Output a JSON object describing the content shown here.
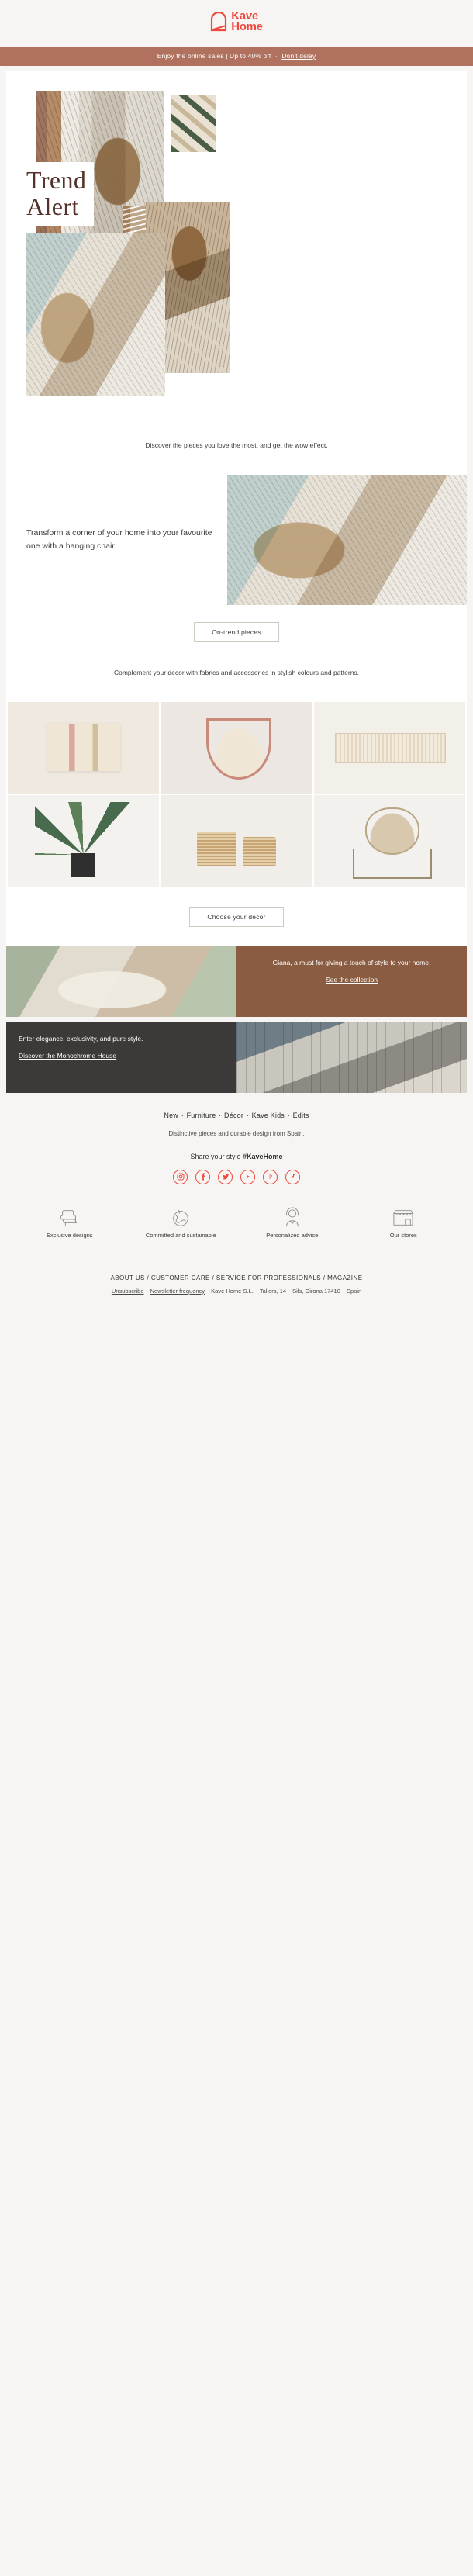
{
  "brand": {
    "name_line1": "Kave",
    "name_line2": "Home",
    "accent_color": "#f0483e",
    "logo_icon": "arch-logo-icon"
  },
  "promo_bar": {
    "text": "Enjoy the online sales | Up to 40% off",
    "separator": "·",
    "link": "Don't delay",
    "background_color": "#b0725e"
  },
  "hero": {
    "title_line1": "Trend",
    "title_line2": "Alert",
    "title_color": "#54322a",
    "images": [
      {
        "name": "hanging-chair-by-window"
      },
      {
        "name": "green-leaf-pattern-swatch"
      },
      {
        "name": "rattan-weave-detail"
      },
      {
        "name": "hanging-chair-with-stand"
      },
      {
        "name": "hanging-chair-terrace"
      }
    ]
  },
  "intro": {
    "text": "Discover the pieces you love the most, and get the wow effect."
  },
  "feature_block": {
    "text": "Transform a corner of your home into your favourite one with a hanging chair.",
    "image_name": "hanging-chair-interior-scene",
    "cta": "On-trend pieces"
  },
  "decor_block": {
    "text": "Complement your decor with fabrics and accessories in stylish colours and patterns.",
    "cta": "Choose your decor",
    "products": [
      {
        "name": "striped-cushion"
      },
      {
        "name": "pink-hanging-chair"
      },
      {
        "name": "woven-rug"
      },
      {
        "name": "potted-palm-plant"
      },
      {
        "name": "woven-baskets"
      },
      {
        "name": "hanging-chair-with-frame"
      }
    ]
  },
  "panels": [
    {
      "name": "giana-collection-panel",
      "text": "Giana, a must for giving a touch of style to your home.",
      "link": "See the collection",
      "image_name": "giana-outdoor-lounge",
      "background_color": "#8a5c41"
    },
    {
      "name": "monochrome-house-panel",
      "text": "Enter elegance, exclusivity, and pure style.",
      "link": "Discover the Monochrome House",
      "image_name": "monochrome-house-terrace",
      "background_color": "#3c3a38"
    }
  ],
  "footer": {
    "nav": [
      "New",
      "Furniture",
      "Décor",
      "Kave Kids",
      "Edits"
    ],
    "nav_separator": "·",
    "tagline": "Distinctive pieces and durable design from Spain.",
    "share_label": "Share your style",
    "share_hashtag": "#KaveHome",
    "socials": [
      {
        "name": "instagram-icon",
        "glyph": "□"
      },
      {
        "name": "facebook-icon",
        "glyph": "f"
      },
      {
        "name": "twitter-icon",
        "glyph": "✈"
      },
      {
        "name": "youtube-icon",
        "glyph": "▶"
      },
      {
        "name": "pinterest-icon",
        "glyph": "P"
      },
      {
        "name": "tiktok-icon",
        "glyph": "♪"
      }
    ],
    "features": [
      {
        "icon": "armchair-icon",
        "label": "Exclusive designs"
      },
      {
        "icon": "globe-leaf-icon",
        "label": "Committed and sustainable"
      },
      {
        "icon": "headset-agent-icon",
        "label": "Personalized advice"
      },
      {
        "icon": "storefront-icon",
        "label": "Our stores"
      }
    ],
    "legal_links": [
      "ABOUT US",
      "CUSTOMER CARE",
      "SERVICE FOR PROFESSIONALS",
      "MAGAZINE"
    ],
    "legal_separator": "/",
    "unsubscribe": "Unsubscribe",
    "newsletter_frequency": "Newsletter frequency",
    "company": "Kave Home S.L.",
    "address": "Tallers, 14",
    "city": "Sils, Girona 17410",
    "country": "Spain"
  }
}
